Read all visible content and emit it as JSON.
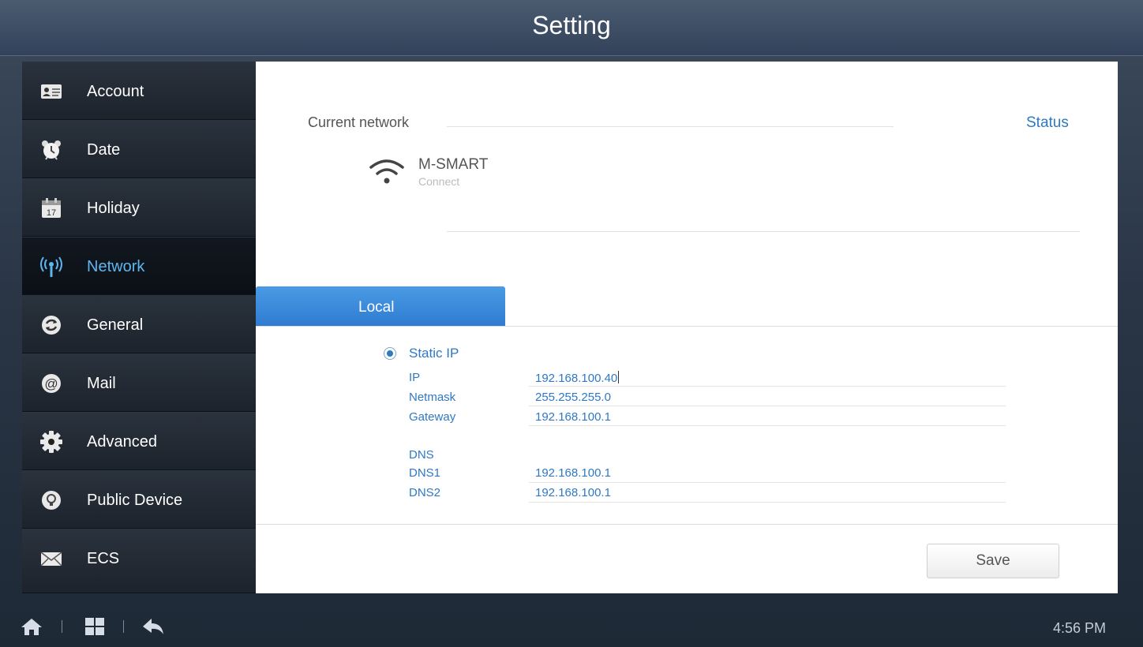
{
  "header": {
    "title": "Setting"
  },
  "sidebar": {
    "items": [
      {
        "label": "Account",
        "icon": "account-card-icon"
      },
      {
        "label": "Date",
        "icon": "alarm-clock-icon"
      },
      {
        "label": "Holiday",
        "icon": "calendar-icon"
      },
      {
        "label": "Network",
        "icon": "antenna-icon",
        "active": true
      },
      {
        "label": "General",
        "icon": "refresh-icon"
      },
      {
        "label": "Mail",
        "icon": "at-sign-icon"
      },
      {
        "label": "Advanced",
        "icon": "gear-icon"
      },
      {
        "label": "Public Device",
        "icon": "bulb-icon"
      },
      {
        "label": "ECS",
        "icon": "envelope-icon"
      }
    ],
    "calendar_day": "17"
  },
  "network": {
    "current_label": "Current network",
    "status_link": "Status",
    "ssid": "M-SMART",
    "ssid_status": "Connect"
  },
  "tabs": {
    "local": "Local"
  },
  "ipconfig": {
    "mode": "Static IP",
    "ip_label": "IP",
    "ip_value": "192.168.100.40",
    "netmask_label": "Netmask",
    "netmask_value": "255.255.255.0",
    "gateway_label": "Gateway",
    "gateway_value": "192.168.100.1",
    "dns_heading": "DNS",
    "dns1_label": "DNS1",
    "dns1_value": "192.168.100.1",
    "dns2_label": "DNS2",
    "dns2_value": "192.168.100.1"
  },
  "actions": {
    "save": "Save"
  },
  "footer": {
    "time": "4:56 PM"
  },
  "colors": {
    "accent": "#2f78c4",
    "active_nav": "#5eb6f0",
    "tab": "#3a8bdc"
  }
}
